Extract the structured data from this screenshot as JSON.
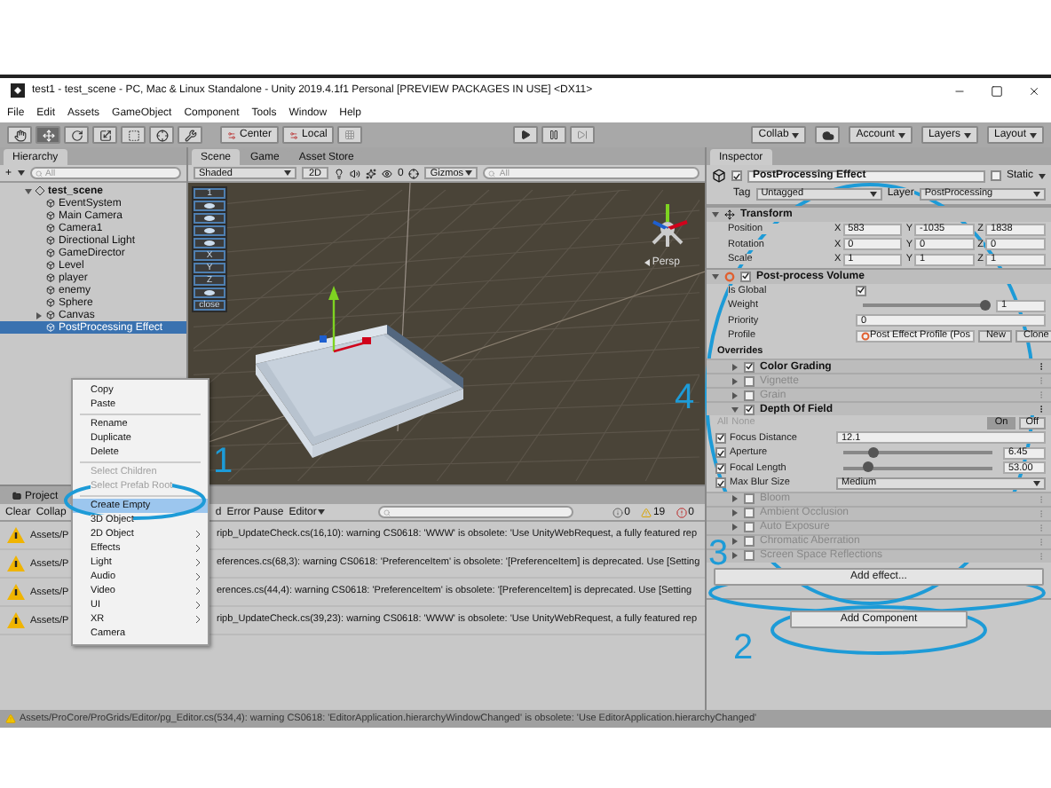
{
  "window": {
    "title": "test1 - test_scene - PC, Mac & Linux Standalone - Unity 2019.4.1f1 Personal [PREVIEW PACKAGES IN USE] <DX11>"
  },
  "menu_bar": [
    "File",
    "Edit",
    "Assets",
    "GameObject",
    "Component",
    "Tools",
    "Window",
    "Help"
  ],
  "toolbar": {
    "tools": [
      {
        "kind": "hand",
        "selected": false
      },
      {
        "kind": "move",
        "selected": true
      },
      {
        "kind": "rotate",
        "selected": false
      },
      {
        "kind": "scale",
        "selected": false
      },
      {
        "kind": "rect",
        "selected": false
      },
      {
        "kind": "transform",
        "selected": false
      },
      {
        "kind": "custom",
        "selected": false
      }
    ],
    "pivots": [
      "Center",
      "Local"
    ],
    "right_buttons": [
      {
        "kind": "dropdown",
        "label": "Collab"
      },
      {
        "kind": "cloud"
      },
      {
        "kind": "dropdown",
        "label": "Account"
      },
      {
        "kind": "dropdown",
        "label": "Layers"
      },
      {
        "kind": "dropdown",
        "label": "Layout"
      }
    ]
  },
  "hierarchy": {
    "tab": "Hierarchy",
    "create": "+",
    "search_placeholder": "All",
    "root": {
      "label": "test_scene",
      "expanded": true,
      "children": [
        {
          "label": "EventSystem",
          "expandable": false,
          "selected": false
        },
        {
          "label": "Main Camera",
          "expandable": false,
          "selected": false
        },
        {
          "label": "Camera1",
          "expandable": false,
          "selected": false
        },
        {
          "label": "Directional Light",
          "expandable": false,
          "selected": false
        },
        {
          "label": "GameDirector",
          "expandable": false,
          "selected": false
        },
        {
          "label": "Level",
          "expandable": false,
          "selected": false
        },
        {
          "label": "player",
          "expandable": false,
          "selected": false
        },
        {
          "label": "enemy",
          "expandable": false,
          "selected": false
        },
        {
          "label": "Sphere",
          "expandable": false,
          "selected": false
        },
        {
          "label": "Canvas",
          "expandable": true,
          "selected": false
        },
        {
          "label": "PostProcessing Effect",
          "expandable": false,
          "selected": true
        }
      ]
    }
  },
  "scene": {
    "tabs": [
      {
        "label": "Scene",
        "selected": true
      },
      {
        "label": "Game",
        "selected": false
      },
      {
        "label": "Asset Store",
        "selected": false
      }
    ],
    "shading": "Shaded",
    "mode_2d": "2D",
    "hidden_count": "0",
    "gizmos": "Gizmos",
    "search_placeholder": "All",
    "persp": "Persp",
    "overlay": [
      {
        "kind": "text",
        "label": "1"
      },
      {
        "kind": "icon"
      },
      {
        "kind": "icon"
      },
      {
        "kind": "icon"
      },
      {
        "kind": "icon"
      },
      {
        "kind": "text",
        "label": "X"
      },
      {
        "kind": "text",
        "label": "Y"
      },
      {
        "kind": "text",
        "label": "Z"
      },
      {
        "kind": "icon"
      },
      {
        "kind": "text",
        "label": "close"
      }
    ]
  },
  "console": {
    "tabs": [
      {
        "label": "Project",
        "selected": false
      }
    ],
    "left_buttons": [
      "Clear",
      "Collap"
    ],
    "right_buttons": [
      "d",
      "Error Pause",
      "Editor"
    ],
    "counts": [
      {
        "kind": "info",
        "label": "0"
      },
      {
        "kind": "warning",
        "label": "19"
      },
      {
        "kind": "error",
        "label": "0"
      }
    ],
    "rows": [
      {
        "head": "Assets/P",
        "tail": "ripb_UpdateCheck.cs(16,10): warning CS0618: 'WWW' is obsolete: 'Use UnityWebRequest, a fully featured rep"
      },
      {
        "head": "Assets/P",
        "tail": "eferences.cs(68,3): warning CS0618: 'PreferenceItem' is obsolete: '[PreferenceItem] is deprecated. Use [Setting"
      },
      {
        "head": "Assets/P",
        "tail": "erences.cs(44,4): warning CS0618: 'PreferenceItem' is obsolete: '[PreferenceItem] is deprecated. Use [Setting"
      },
      {
        "head": "Assets/P",
        "tail": "ripb_UpdateCheck.cs(39,23): warning CS0618: 'WWW' is obsolete: 'Use UnityWebRequest, a fully featured rep"
      }
    ]
  },
  "context_menu": {
    "groups": [
      {
        "items": [
          {
            "label": "Copy",
            "disabled": false,
            "submenu": false,
            "selected": false
          },
          {
            "label": "Paste",
            "disabled": false,
            "submenu": false,
            "selected": false
          }
        ]
      },
      {
        "items": [
          {
            "label": "Rename",
            "disabled": false,
            "submenu": false,
            "selected": false
          },
          {
            "label": "Duplicate",
            "disabled": false,
            "submenu": false,
            "selected": false
          },
          {
            "label": "Delete",
            "disabled": false,
            "submenu": false,
            "selected": false
          }
        ]
      },
      {
        "items": [
          {
            "label": "Select Children",
            "disabled": true,
            "submenu": false,
            "selected": false
          },
          {
            "label": "Select Prefab Root",
            "disabled": true,
            "submenu": false,
            "selected": false
          }
        ]
      },
      {
        "items": [
          {
            "label": "Create Empty",
            "disabled": false,
            "submenu": false,
            "selected": true
          },
          {
            "label": "3D Object",
            "disabled": false,
            "submenu": false,
            "selected": false
          },
          {
            "label": "2D Object",
            "disabled": false,
            "submenu": true,
            "selected": false
          },
          {
            "label": "Effects",
            "disabled": false,
            "submenu": true,
            "selected": false
          },
          {
            "label": "Light",
            "disabled": false,
            "submenu": true,
            "selected": false
          },
          {
            "label": "Audio",
            "disabled": false,
            "submenu": true,
            "selected": false
          },
          {
            "label": "Video",
            "disabled": false,
            "submenu": true,
            "selected": false
          },
          {
            "label": "UI",
            "disabled": false,
            "submenu": true,
            "selected": false
          },
          {
            "label": "XR",
            "disabled": false,
            "submenu": true,
            "selected": false
          },
          {
            "label": "Camera",
            "disabled": false,
            "submenu": false,
            "selected": false
          }
        ]
      }
    ]
  },
  "inspector": {
    "tab": "Inspector",
    "object": {
      "active": true,
      "name": "PostProcessing Effect",
      "static": false,
      "static_label": "Static",
      "tag_label": "Tag",
      "tag": "Untagged",
      "layer_label": "Layer",
      "layer": "PostProcessing"
    },
    "transform": {
      "title": "Transform",
      "rows": [
        {
          "label": "Position",
          "values": [
            {
              "axis": "X",
              "value": "583"
            },
            {
              "axis": "Y",
              "value": "-1035"
            },
            {
              "axis": "Z",
              "value": "1838"
            }
          ]
        },
        {
          "label": "Rotation",
          "values": [
            {
              "axis": "X",
              "value": "0"
            },
            {
              "axis": "Y",
              "value": "0"
            },
            {
              "axis": "Z",
              "value": "0"
            }
          ]
        },
        {
          "label": "Scale",
          "values": [
            {
              "axis": "X",
              "value": "1"
            },
            {
              "axis": "Y",
              "value": "1"
            },
            {
              "axis": "Z",
              "value": "1"
            }
          ]
        }
      ]
    },
    "volume": {
      "title": "Post-process Volume",
      "enabled": true,
      "fields": [
        {
          "kind": "checkbox",
          "label": "Is Global",
          "checked": true
        },
        {
          "kind": "slider",
          "label": "Weight",
          "level": 1,
          "value": "1"
        },
        {
          "kind": "text",
          "label": "Priority",
          "value": "0"
        },
        {
          "kind": "profile",
          "label": "Profile",
          "value": "Post Effect Profile (Pos",
          "buttons": [
            "New",
            "Clone"
          ]
        }
      ],
      "overrides_label": "Overrides",
      "effects": [
        {
          "label": "Color Grading",
          "enabled": true,
          "expanded": false
        },
        {
          "label": "Vignette",
          "enabled": false,
          "expanded": false
        },
        {
          "label": "Grain",
          "enabled": false,
          "expanded": false
        },
        {
          "label": "Depth Of Field",
          "enabled": true,
          "expanded": true,
          "all_none": [
            "All",
            "None"
          ],
          "modes": [
            {
              "label": "On",
              "selected": true
            },
            {
              "label": "Off",
              "selected": false
            }
          ],
          "properties": [
            {
              "kind": "number",
              "label": "Focus Distance",
              "overridden": true,
              "value": "12.1"
            },
            {
              "kind": "slider",
              "label": "Aperture",
              "overridden": true,
              "level": 0.2,
              "value": "6.45"
            },
            {
              "kind": "slider",
              "label": "Focal Length",
              "overridden": true,
              "level": 0.17,
              "value": "53.00"
            },
            {
              "kind": "dropdown",
              "label": "Max Blur Size",
              "overridden": true,
              "value": "Medium"
            }
          ]
        },
        {
          "label": "Bloom",
          "enabled": false,
          "expanded": false
        },
        {
          "label": "Ambient Occlusion",
          "enabled": false,
          "expanded": false
        },
        {
          "label": "Auto Exposure",
          "enabled": false,
          "expanded": false
        },
        {
          "label": "Chromatic Aberration",
          "enabled": false,
          "expanded": false
        },
        {
          "label": "Screen Space Reflections",
          "enabled": false,
          "expanded": false
        }
      ],
      "add_effect": "Add effect..."
    },
    "add_component": "Add Component"
  },
  "status_bar": {
    "message": "Assets/ProCore/ProGrids/Editor/pg_Editor.cs(534,4): warning CS0618: 'EditorApplication.hierarchyWindowChanged' is obsolete: 'Use EditorApplication.hierarchyChanged'"
  },
  "annotations": [
    {
      "label": "1"
    },
    {
      "label": "4"
    },
    {
      "label": "3"
    },
    {
      "label": "2"
    }
  ]
}
